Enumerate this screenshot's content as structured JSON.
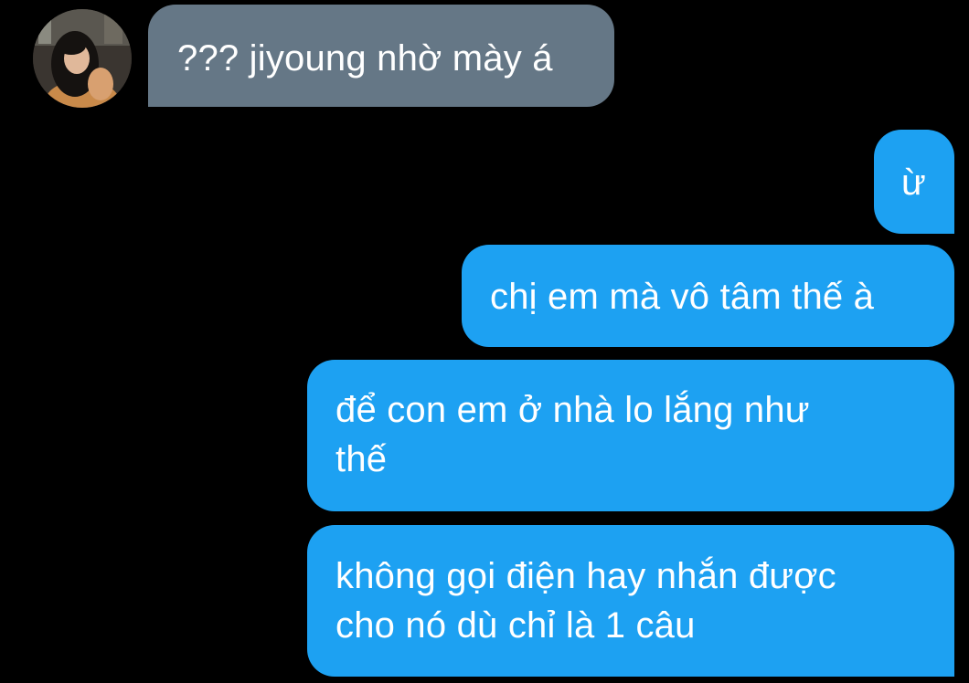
{
  "contact": {
    "avatar": "avatar-photo"
  },
  "messages": {
    "received_1": "??? jiyoung nhờ mày á",
    "sent_1": "ừ",
    "sent_2": "chị em mà vô tâm thế à",
    "sent_3": {
      "line_1": "để con em ở nhà lo lắng như",
      "line_2": "thế"
    },
    "sent_4": {
      "line_1": "không gọi điện hay nhắn được",
      "line_2": "cho nó dù chỉ là 1 câu"
    }
  },
  "colors": {
    "background": "#000000",
    "received_bubble": "#657786",
    "sent_bubble": "#1da1f2",
    "text": "#ffffff"
  }
}
